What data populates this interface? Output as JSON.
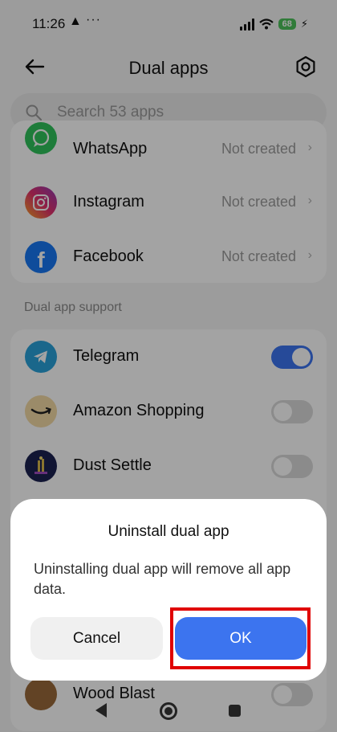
{
  "status_bar": {
    "time": "11:26",
    "warning_icon": "warning-icon",
    "more": "···",
    "battery": "68"
  },
  "header": {
    "title": "Dual apps"
  },
  "search": {
    "placeholder": "Search 53 apps"
  },
  "installed_apps": [
    {
      "name": "WhatsApp",
      "status": "Not created"
    },
    {
      "name": "Instagram",
      "status": "Not created"
    },
    {
      "name": "Facebook",
      "status": "Not created"
    }
  ],
  "support_section": {
    "label": "Dual app support",
    "items": [
      {
        "name": "Telegram",
        "enabled": true
      },
      {
        "name": "Amazon Shopping",
        "enabled": false
      },
      {
        "name": "Dust Settle",
        "enabled": false
      },
      {
        "name": "Wood Blast",
        "enabled": false
      }
    ]
  },
  "dialog": {
    "title": "Uninstall dual app",
    "message": "Uninstalling dual app will remove all app data.",
    "cancel_label": "Cancel",
    "ok_label": "OK"
  },
  "colors": {
    "accent": "#3c74ef",
    "highlight": "#e00000",
    "battery": "#4cc05a"
  }
}
